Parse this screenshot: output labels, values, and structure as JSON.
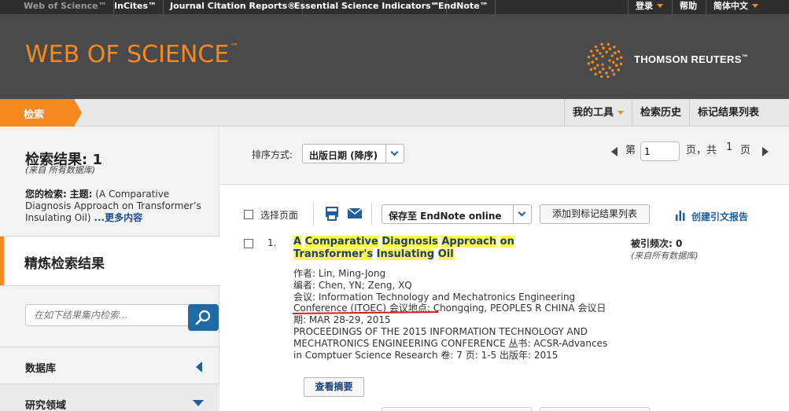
{
  "topbar": {
    "products": [
      "Web of Science™",
      "InCites™",
      "Journal Citation Reports®",
      "Essential Science Indicators℠",
      "EndNote™"
    ],
    "login": "登录",
    "help": "帮助",
    "language": "简体中文"
  },
  "header": {
    "brand": "WEB OF SCIENCE",
    "brand_tm": "™",
    "publisher": "THOMSON REUTERS",
    "publisher_tm": "™"
  },
  "nav": {
    "search_tab": "检索",
    "my_tools": "我的工具",
    "search_history": "检索历史",
    "marked_list": "标记结果列表"
  },
  "sidebar": {
    "results_title": "检索结果: 1",
    "results_source": "(来自 所有数据库)",
    "your_search_label": "您的检索:",
    "topic_label": "主题:",
    "query": "(A Comparative Diagnosis Approach on Transformer’s Insulating Oil)",
    "more": "...更多内容",
    "refine_title": "精炼检索结果",
    "search_placeholder": "在如下结果集内检索...",
    "facets": [
      "数据库",
      "研究领域"
    ]
  },
  "sortbar": {
    "label": "排序方式:",
    "value": "出版日期 (降序)",
    "page_prefix": "第",
    "page_value": "1",
    "page_suffix": "页，共",
    "total_pages": "1",
    "page_word": "页"
  },
  "toolbar": {
    "select_page": "选择页面",
    "save_endnote": "保存至 EndNote online",
    "add_marked": "添加到标记结果列表",
    "citation_report": "创建引文报告"
  },
  "result": {
    "number": "1.",
    "title_words": [
      "A",
      "Comparative",
      "Diagnosis",
      "Approach",
      "on",
      "Transformer's",
      "Insulating",
      "Oil"
    ],
    "authors": "作者: Lin, Ming-Jong",
    "editors": "编者: Chen, YN; Zeng, XQ",
    "meta_lines": [
      "会议: Information Technology and Mechatronics Engineering Conference (ITOEC) 会议地点: Chongqing, PEOPLES R CHINA 会议日期: MAR 28-29, 2015",
      "PROCEEDINGS OF THE 2015 INFORMATION TECHNOLOGY AND MECHATRONICS ENGINEERING CONFERENCE  丛书: ACSR-Advances in Comptuer Science Research   卷: 7   页: 1-5   出版年: 2015"
    ],
    "cited_label": "被引频次: 0",
    "cited_source": "(来自所有数据库)",
    "abstract_button": "查看摘要"
  },
  "colors": {
    "accent": "#f5891f",
    "header_bg": "#4a4a4a",
    "topbar_bg": "#2e2e2e",
    "link_blue": "#1f5f9f",
    "highlight": "#fff54c",
    "annotation_red": "#d41f1f"
  },
  "icons": [
    "chevron-down-icon",
    "search-icon",
    "print-icon",
    "email-icon",
    "bar-chart-icon",
    "triangle-left-icon",
    "triangle-down-icon",
    "page-prev-icon",
    "page-next-icon",
    "thomson-reuters-logo"
  ]
}
